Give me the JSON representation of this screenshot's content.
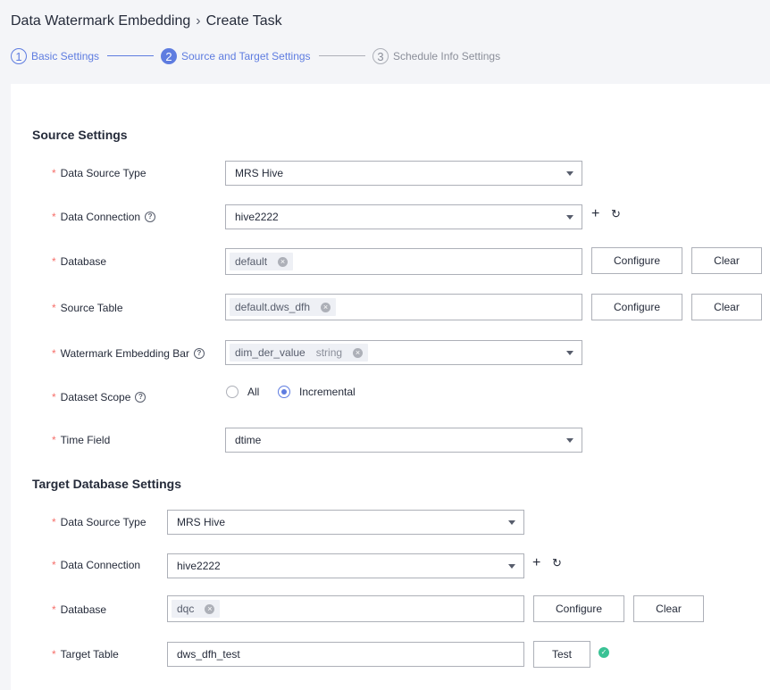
{
  "breadcrumb": {
    "parent": "Data Watermark Embedding",
    "current": "Create Task"
  },
  "steps": [
    {
      "num": "1",
      "label": "Basic Settings",
      "state": "done"
    },
    {
      "num": "2",
      "label": "Source and Target Settings",
      "state": "active"
    },
    {
      "num": "3",
      "label": "Schedule Info Settings",
      "state": "todo"
    }
  ],
  "source": {
    "title": "Source Settings",
    "data_source_type": {
      "label": "Data Source Type",
      "value": "MRS Hive"
    },
    "data_connection": {
      "label": "Data Connection",
      "value": "hive2222"
    },
    "database": {
      "label": "Database",
      "tag": "default",
      "configure": "Configure",
      "clear": "Clear"
    },
    "source_table": {
      "label": "Source Table",
      "tag": "default.dws_dfh",
      "configure": "Configure",
      "clear": "Clear"
    },
    "watermark_bar": {
      "label": "Watermark Embedding Bar",
      "tag": "dim_der_value",
      "tag_type": "string"
    },
    "dataset_scope": {
      "label": "Dataset Scope",
      "options": [
        "All",
        "Incremental"
      ],
      "selected": "Incremental"
    },
    "time_field": {
      "label": "Time Field",
      "value": "dtime"
    }
  },
  "target": {
    "title": "Target Database Settings",
    "data_source_type": {
      "label": "Data Source Type",
      "value": "MRS Hive"
    },
    "data_connection": {
      "label": "Data Connection",
      "value": "hive2222"
    },
    "database": {
      "label": "Database",
      "tag": "dqc",
      "configure": "Configure",
      "clear": "Clear"
    },
    "target_table": {
      "label": "Target Table",
      "value": "dws_dfh_test",
      "test": "Test"
    }
  },
  "icons": {
    "required": "*",
    "help": "?",
    "plus": "+",
    "refresh": "↻",
    "remove": "×",
    "success": "✓"
  },
  "colors": {
    "accent": "#5e7ce0",
    "required": "#f66f6a",
    "success": "#3ac295",
    "border": "#adb0b8"
  }
}
